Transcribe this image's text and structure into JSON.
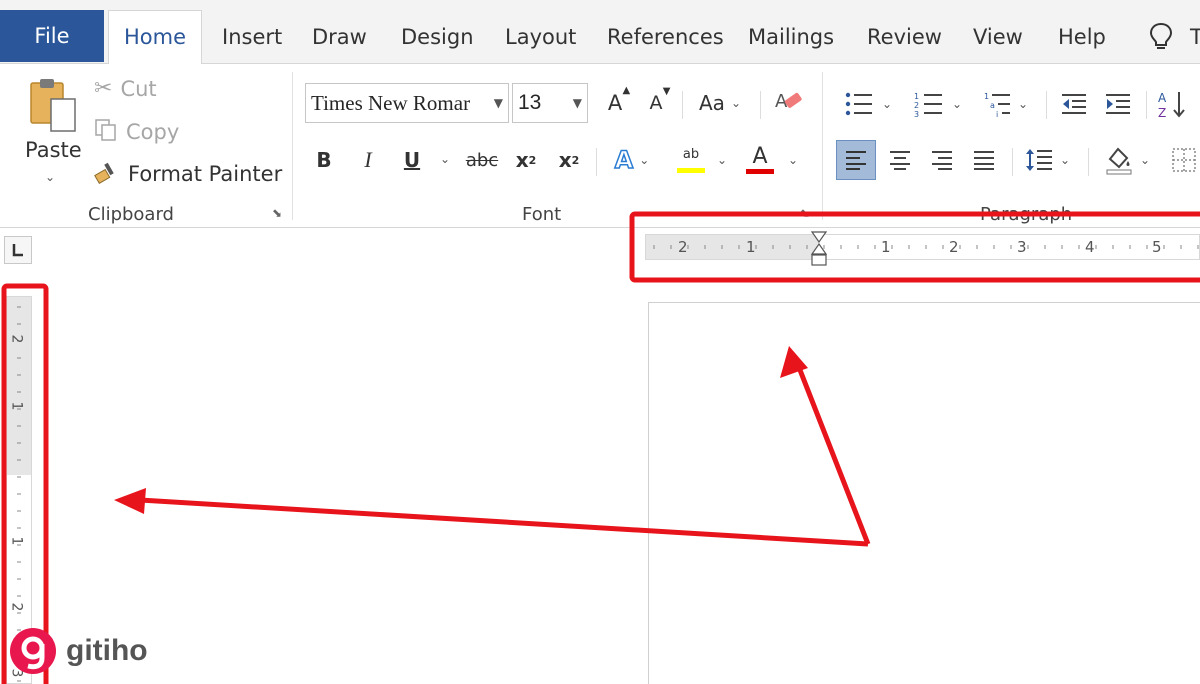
{
  "tabs": {
    "file": "File",
    "home": "Home",
    "insert": "Insert",
    "draw": "Draw",
    "design": "Design",
    "layout": "Layout",
    "references": "References",
    "mailings": "Mailings",
    "review": "Review",
    "view": "View",
    "help": "Help",
    "tell_me_partial": "T"
  },
  "clipboard": {
    "paste": "Paste",
    "cut": "Cut",
    "copy": "Copy",
    "format_painter": "Format Painter",
    "group_label": "Clipboard"
  },
  "font": {
    "font_name": "Times New Romar",
    "font_size": "13",
    "change_case": "Aa",
    "bold": "B",
    "italic": "I",
    "underline": "U",
    "strikethrough": "abc",
    "subscript_base": "x",
    "subscript_mark": "2",
    "superscript_base": "x",
    "superscript_mark": "2",
    "highlight_glyph": "ab",
    "font_color_glyph": "A",
    "text_effects_glyph": "A",
    "grow_glyph": "A",
    "shrink_glyph": "A",
    "group_label": "Font",
    "highlight_color": "#ffff00",
    "font_color": "#e00000"
  },
  "paragraph": {
    "group_label": "Paragraph"
  },
  "ruler": {
    "horizontal_ticks": [
      "2",
      "1",
      "1",
      "2",
      "3",
      "4",
      "5"
    ],
    "vertical_ticks": [
      "2",
      "1",
      "1",
      "2",
      "3"
    ]
  },
  "watermark": {
    "text": "gitiho"
  },
  "colors": {
    "accent": "#2b579a",
    "annotation": "#e8141b"
  }
}
